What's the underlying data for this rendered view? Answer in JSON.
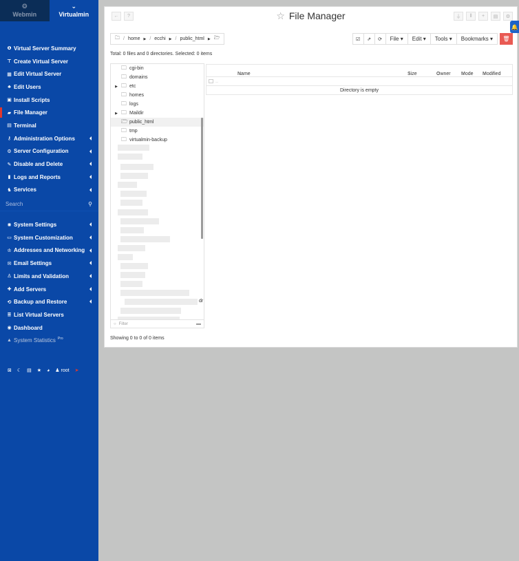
{
  "switcher": {
    "webmin": "Webmin",
    "virtualmin": "Virtualmin"
  },
  "sidebar": {
    "items_top": [
      {
        "label": "Virtual Server Summary",
        "icon": "info-icon"
      },
      {
        "label": "Create Virtual Server",
        "icon": "server-plus-icon"
      },
      {
        "label": "Edit Virtual Server",
        "icon": "grid-icon"
      },
      {
        "label": "Edit Users",
        "icon": "users-icon"
      },
      {
        "label": "Install Scripts",
        "icon": "script-icon"
      },
      {
        "label": "File Manager",
        "icon": "folder-icon",
        "active": true
      },
      {
        "label": "Terminal",
        "icon": "terminal-icon"
      },
      {
        "label": "Administration Options",
        "icon": "key-icon",
        "caret": true
      },
      {
        "label": "Server Configuration",
        "icon": "gears-icon",
        "caret": true
      },
      {
        "label": "Disable and Delete",
        "icon": "wrench-icon",
        "caret": true
      },
      {
        "label": "Logs and Reports",
        "icon": "report-icon",
        "caret": true
      },
      {
        "label": "Services",
        "icon": "services-icon",
        "caret": true
      }
    ],
    "search_placeholder": "Search",
    "items_bottom": [
      {
        "label": "System Settings",
        "icon": "cog-icon",
        "caret": true
      },
      {
        "label": "System Customization",
        "icon": "laptop-icon",
        "caret": true
      },
      {
        "label": "Addresses and Networking",
        "icon": "network-icon",
        "caret": true
      },
      {
        "label": "Email Settings",
        "icon": "envelope-icon",
        "caret": true
      },
      {
        "label": "Limits and Validation",
        "icon": "person-icon",
        "caret": true
      },
      {
        "label": "Add Servers",
        "icon": "plus-icon",
        "caret": true
      },
      {
        "label": "Backup and Restore",
        "icon": "history-icon",
        "caret": true
      },
      {
        "label": "List Virtual Servers",
        "icon": "list-icon"
      },
      {
        "label": "Dashboard",
        "icon": "dashboard-icon"
      },
      {
        "label": "System Statistics",
        "icon": "chart-icon",
        "dim": true,
        "pro": "Pro"
      }
    ],
    "bottom_user": "root"
  },
  "title": "File Manager",
  "breadcrumb": [
    "home",
    "ecchi",
    "public_html"
  ],
  "toolbar": {
    "file": "File",
    "edit": "Edit",
    "tools": "Tools",
    "bookmarks": "Bookmarks"
  },
  "totals": "Total: 0 files and 0 directories. Selected: 0 items",
  "tree": [
    {
      "label": "cgi-bin",
      "expand": false
    },
    {
      "label": "domains",
      "expand": false
    },
    {
      "label": "etc",
      "expand": true
    },
    {
      "label": "homes",
      "expand": false
    },
    {
      "label": "logs",
      "expand": false
    },
    {
      "label": "Maildir",
      "expand": true
    },
    {
      "label": "public_html",
      "expand": false,
      "selected": true
    },
    {
      "label": "tmp",
      "expand": false
    },
    {
      "label": "virtualmin-backup",
      "expand": false
    }
  ],
  "tree_fragment": "dr",
  "filter_placeholder": "Filter",
  "table": {
    "columns": [
      "Name",
      "Size",
      "Owner",
      "Mode",
      "Modified"
    ],
    "up": "..",
    "empty": "Directory is empty"
  },
  "showing": "Showing 0 to 0 of 0 items"
}
